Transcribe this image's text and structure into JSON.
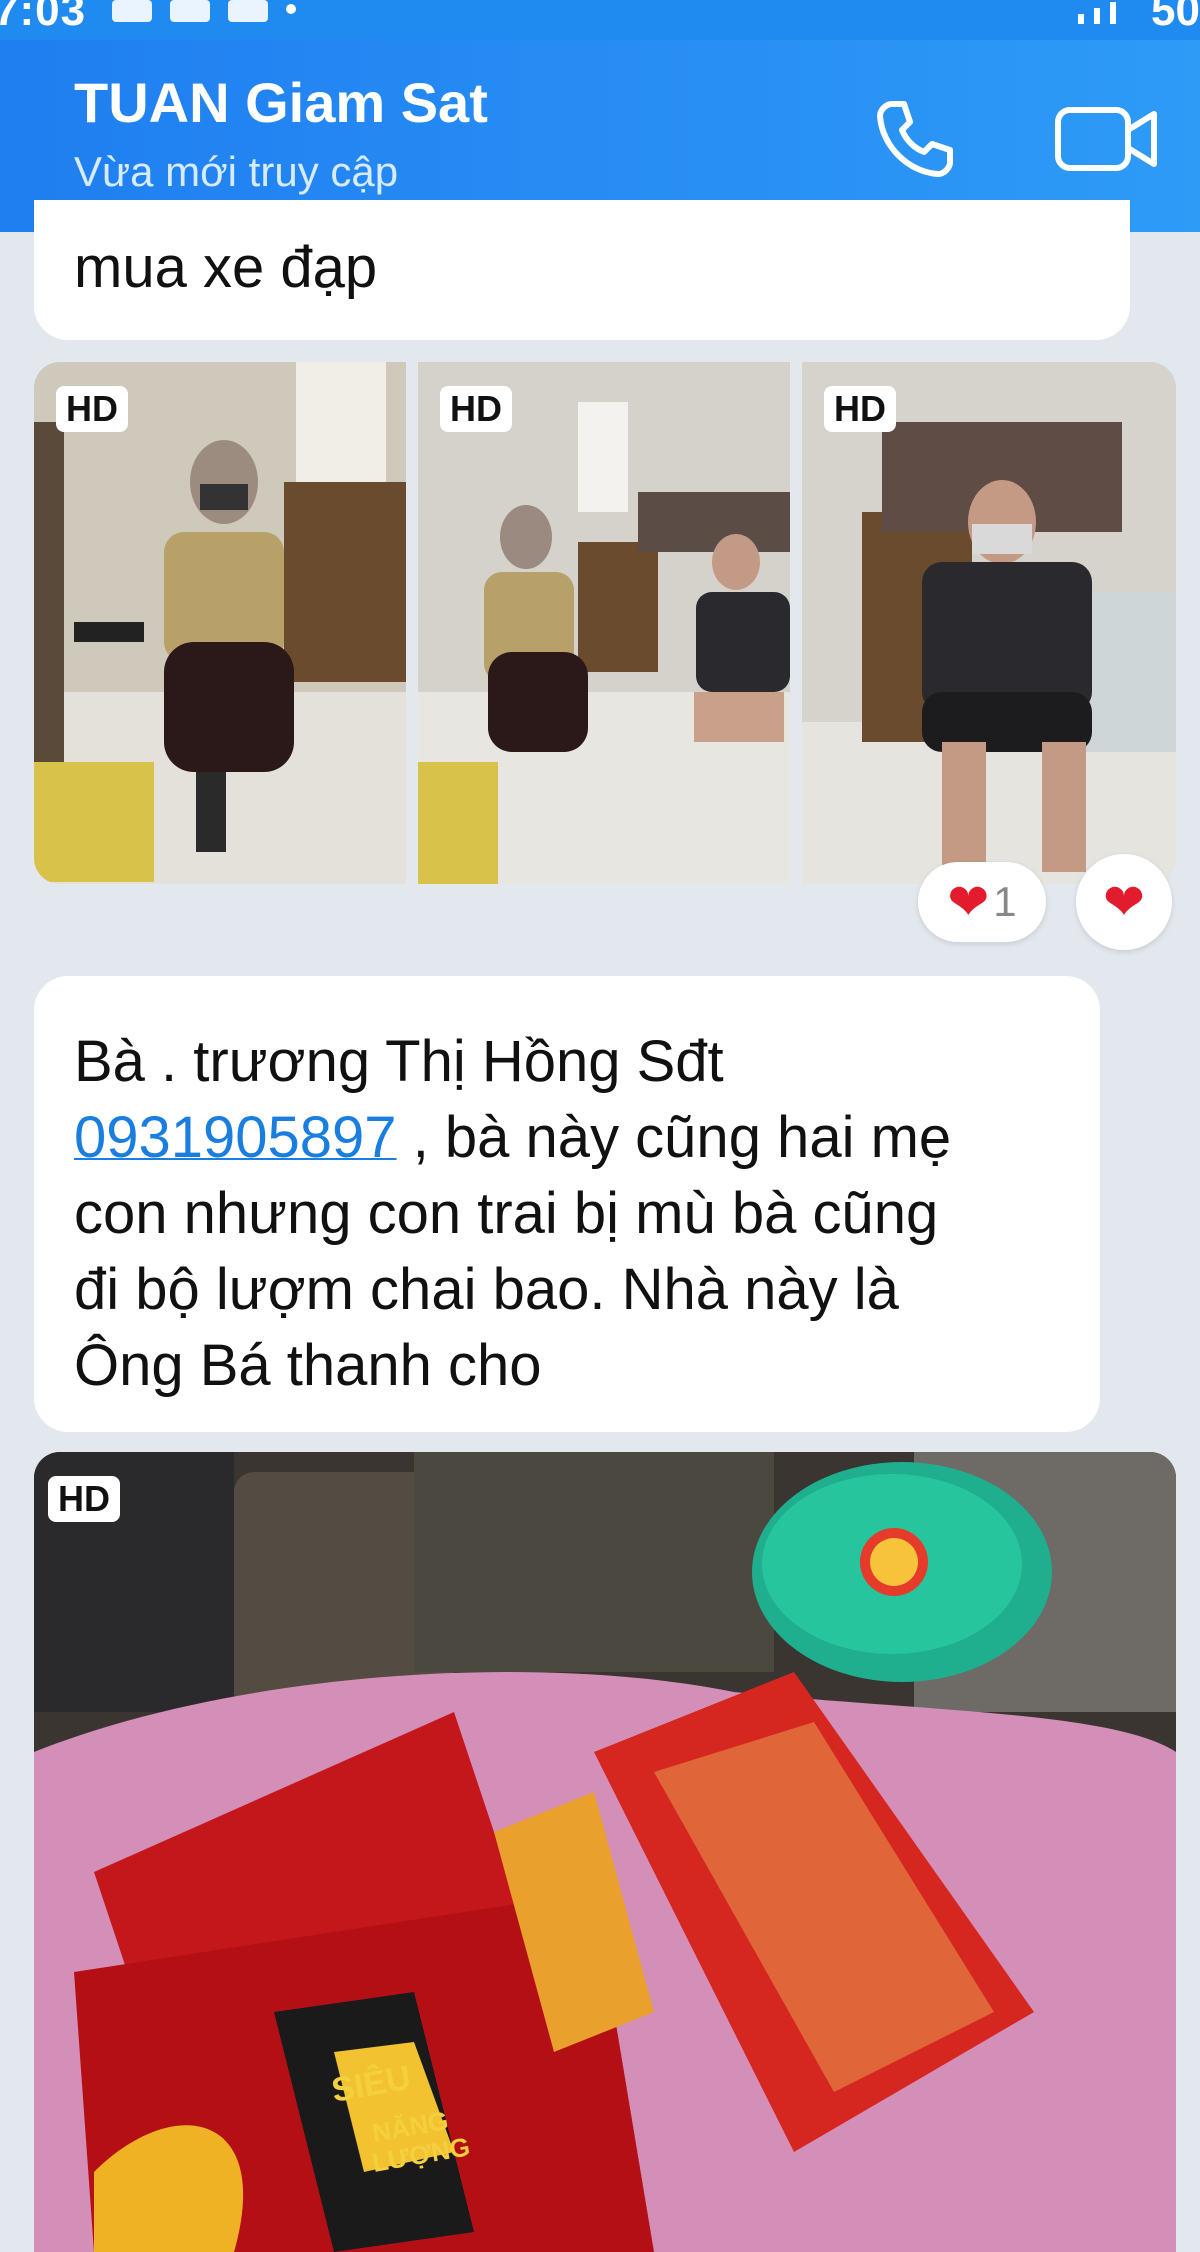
{
  "status_bar": {
    "time": "7:03",
    "right_text": "50"
  },
  "header": {
    "contact_name": "TUAN Giam Sat",
    "contact_status": "Vừa mới truy cập"
  },
  "messages": {
    "top_fragment": "mua xe đạp",
    "photo_badges": [
      "HD",
      "HD",
      "HD"
    ],
    "reaction": {
      "count": "1"
    },
    "main_text": {
      "line1": "Bà . trương Thị Hồng  Sđt",
      "phone": "0931905897",
      "line2_rest": " ,  bà này cũng hai mẹ",
      "line3": "con nhưng con trai bị mù  bà cũng",
      "line4": "đi bộ lượm chai bao. Nhà này là",
      "line5": "Ông Bá thanh cho"
    },
    "last_photo_badge": "HD",
    "last_photo_print": {
      "package_text_1": "SIÊU",
      "package_text_2": "NĂNG",
      "package_text_3": "LƯỢNG"
    }
  },
  "colors": {
    "header_blue": "#1f7ef0",
    "chat_bg": "#e3e8ef",
    "link_blue": "#1a7de0",
    "heart_red": "#e21b2d"
  },
  "icons": [
    "phone-icon",
    "video-call-icon",
    "heart-icon"
  ]
}
